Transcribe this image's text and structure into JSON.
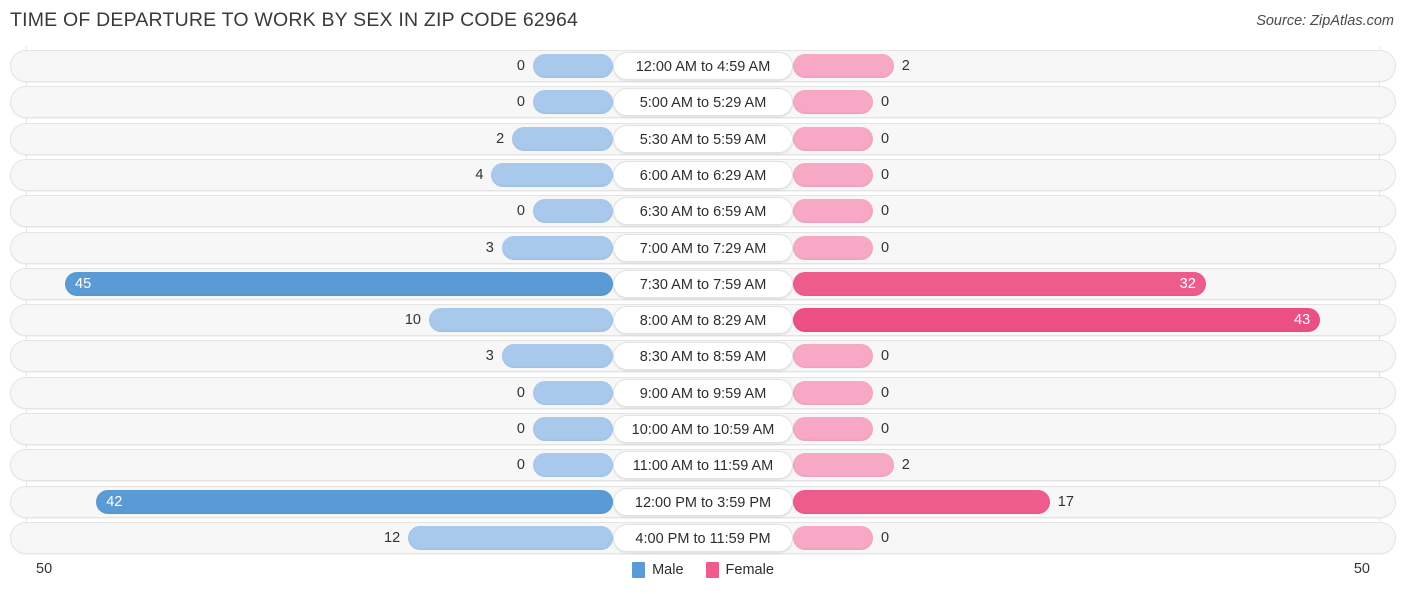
{
  "header": {
    "title": "TIME OF DEPARTURE TO WORK BY SEX IN ZIP CODE 62964",
    "source": "Source: ZipAtlas.com"
  },
  "axis": {
    "left_max_label": "50",
    "right_max_label": "50"
  },
  "legend": {
    "items": [
      {
        "label": "Male",
        "color": "#5b9bd5",
        "icon": "legend-swatch-male"
      },
      {
        "label": "Female",
        "color": "#ee5c8c",
        "icon": "legend-swatch-female"
      }
    ]
  },
  "chart_data": {
    "type": "bar",
    "subtype": "diverging-horizontal-bar",
    "title": "TIME OF DEPARTURE TO WORK BY SEX IN ZIP CODE 62964",
    "xlabel": "",
    "ylabel": "",
    "xlim": [
      50,
      50
    ],
    "axis_max": 50,
    "grid": false,
    "legend_position": "bottom-center",
    "categories": [
      "12:00 AM to 4:59 AM",
      "5:00 AM to 5:29 AM",
      "5:30 AM to 5:59 AM",
      "6:00 AM to 6:29 AM",
      "6:30 AM to 6:59 AM",
      "7:00 AM to 7:29 AM",
      "7:30 AM to 7:59 AM",
      "8:00 AM to 8:29 AM",
      "8:30 AM to 8:59 AM",
      "9:00 AM to 9:59 AM",
      "10:00 AM to 10:59 AM",
      "11:00 AM to 11:59 AM",
      "12:00 PM to 3:59 PM",
      "4:00 PM to 11:59 PM"
    ],
    "series": [
      {
        "name": "Male",
        "direction": "left",
        "color": "#5b9bd5",
        "values": [
          0,
          0,
          2,
          4,
          0,
          3,
          45,
          10,
          3,
          0,
          0,
          0,
          42,
          12
        ],
        "labels": [
          "0",
          "0",
          "2",
          "4",
          "0",
          "3",
          "45",
          "10",
          "3",
          "0",
          "0",
          "0",
          "42",
          "12"
        ]
      },
      {
        "name": "Female",
        "direction": "right",
        "color": "#ee5c8c",
        "values": [
          2,
          0,
          0,
          0,
          0,
          0,
          32,
          43,
          0,
          0,
          0,
          2,
          17,
          0
        ],
        "labels": [
          "2",
          "0",
          "0",
          "0",
          "0",
          "0",
          "32",
          "43",
          "0",
          "0",
          "0",
          "2",
          "17",
          "0"
        ]
      }
    ]
  }
}
